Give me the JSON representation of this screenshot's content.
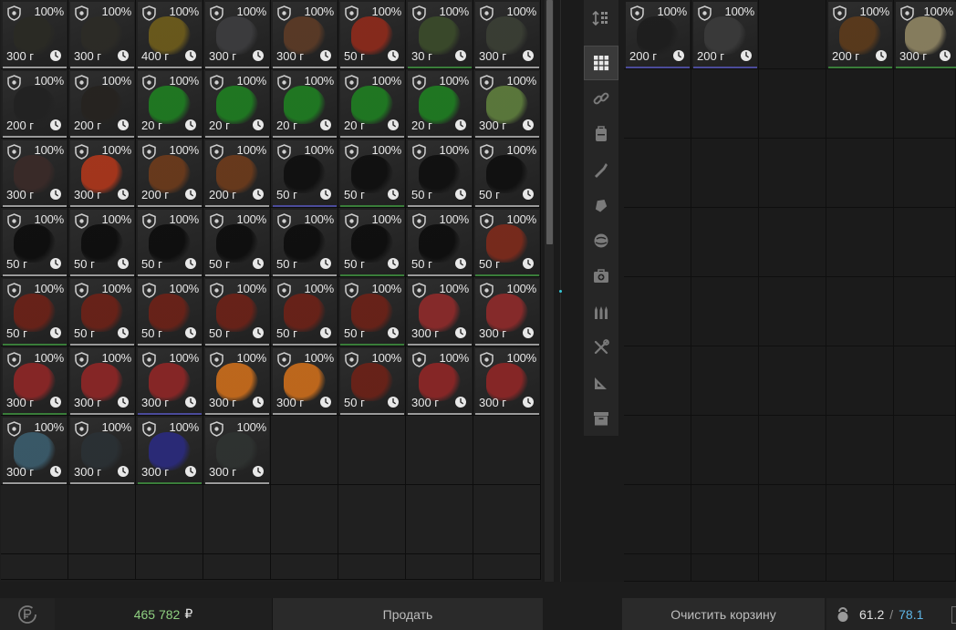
{
  "colors": {
    "accent": "#36c6d4",
    "balance": "#8fd080",
    "weight_max": "#5fb6e6"
  },
  "icons": {
    "item_badge": "shield-icon",
    "item_timer": "clock-icon",
    "refresh": "ruble-refresh-icon",
    "weight": "kettlebell-icon"
  },
  "inventory": {
    "items": [
      {
        "pct": "100%",
        "price": "300 г",
        "art": "#2a2a24",
        "r": "w"
      },
      {
        "pct": "100%",
        "price": "300 г",
        "art": "#2c2b26",
        "r": "w"
      },
      {
        "pct": "100%",
        "price": "400 г",
        "art": "#6b5a1c",
        "r": "w"
      },
      {
        "pct": "100%",
        "price": "300 г",
        "art": "#3c3c3e",
        "r": "w"
      },
      {
        "pct": "100%",
        "price": "300 г",
        "art": "#5a3a26",
        "r": "w"
      },
      {
        "pct": "100%",
        "price": "50 г",
        "art": "#8a2a1c",
        "r": "w"
      },
      {
        "pct": "100%",
        "price": "30 г",
        "art": "#3a4a2a",
        "r": "g"
      },
      {
        "pct": "100%",
        "price": "300 г",
        "art": "#3a3e34",
        "r": "w"
      },
      {
        "pct": "100%",
        "price": "200 г",
        "art": "#222222",
        "r": "w"
      },
      {
        "pct": "100%",
        "price": "200 г",
        "art": "#262320",
        "r": "w"
      },
      {
        "pct": "100%",
        "price": "20 г",
        "art": "#1f7a22",
        "r": "w"
      },
      {
        "pct": "100%",
        "price": "20 г",
        "art": "#1f7a22",
        "r": "w"
      },
      {
        "pct": "100%",
        "price": "20 г",
        "art": "#1f7a22",
        "r": "w"
      },
      {
        "pct": "100%",
        "price": "20 г",
        "art": "#1f7a22",
        "r": "w"
      },
      {
        "pct": "100%",
        "price": "20 г",
        "art": "#1f7a22",
        "r": "w"
      },
      {
        "pct": "100%",
        "price": "300 г",
        "art": "#5c7a3c",
        "r": "w"
      },
      {
        "pct": "100%",
        "price": "300 г",
        "art": "#3a2a28",
        "r": "w"
      },
      {
        "pct": "100%",
        "price": "300 г",
        "art": "#a8361c",
        "r": "w"
      },
      {
        "pct": "100%",
        "price": "200 г",
        "art": "#6a3a1c",
        "r": "w"
      },
      {
        "pct": "100%",
        "price": "200 г",
        "art": "#6a3a1c",
        "r": "w"
      },
      {
        "pct": "100%",
        "price": "50 г",
        "art": "#101010",
        "r": "p"
      },
      {
        "pct": "100%",
        "price": "50 г",
        "art": "#101010",
        "r": "g"
      },
      {
        "pct": "100%",
        "price": "50 г",
        "art": "#101010",
        "r": "w"
      },
      {
        "pct": "100%",
        "price": "50 г",
        "art": "#101010",
        "r": "w"
      },
      {
        "pct": "100%",
        "price": "50 г",
        "art": "#0e0e0e",
        "r": "w"
      },
      {
        "pct": "100%",
        "price": "50 г",
        "art": "#0e0e0e",
        "r": "w"
      },
      {
        "pct": "100%",
        "price": "50 г",
        "art": "#0e0e0e",
        "r": "w"
      },
      {
        "pct": "100%",
        "price": "50 г",
        "art": "#0e0e0e",
        "r": "w"
      },
      {
        "pct": "100%",
        "price": "50 г",
        "art": "#0e0e0e",
        "r": "w"
      },
      {
        "pct": "100%",
        "price": "50 г",
        "art": "#0e0e0e",
        "r": "g"
      },
      {
        "pct": "100%",
        "price": "50 г",
        "art": "#0e0e0e",
        "r": "w"
      },
      {
        "pct": "100%",
        "price": "50 г",
        "art": "#7a2a1c",
        "r": "g"
      },
      {
        "pct": "100%",
        "price": "50 г",
        "art": "#6a2218",
        "r": "g"
      },
      {
        "pct": "100%",
        "price": "50 г",
        "art": "#6a2218",
        "r": "w"
      },
      {
        "pct": "100%",
        "price": "50 г",
        "art": "#6a2218",
        "r": "w"
      },
      {
        "pct": "100%",
        "price": "50 г",
        "art": "#6a2218",
        "r": "w"
      },
      {
        "pct": "100%",
        "price": "50 г",
        "art": "#6a2218",
        "r": "w"
      },
      {
        "pct": "100%",
        "price": "50 г",
        "art": "#6a2218",
        "r": "g"
      },
      {
        "pct": "100%",
        "price": "300 г",
        "art": "#8a2a2a",
        "r": "w"
      },
      {
        "pct": "100%",
        "price": "300 г",
        "art": "#8a2a2a",
        "r": "w"
      },
      {
        "pct": "100%",
        "price": "300 г",
        "art": "#8a2626",
        "r": "g"
      },
      {
        "pct": "100%",
        "price": "300 г",
        "art": "#8a2626",
        "r": "w"
      },
      {
        "pct": "100%",
        "price": "300 г",
        "art": "#8a2626",
        "r": "p"
      },
      {
        "pct": "100%",
        "price": "300 г",
        "art": "#c46a1c",
        "r": "w"
      },
      {
        "pct": "100%",
        "price": "300 г",
        "art": "#c46a1c",
        "r": "w"
      },
      {
        "pct": "100%",
        "price": "50 г",
        "art": "#6a2218",
        "r": "w"
      },
      {
        "pct": "100%",
        "price": "300 г",
        "art": "#8a2626",
        "r": "w"
      },
      {
        "pct": "100%",
        "price": "300 г",
        "art": "#8a2626",
        "r": "w"
      },
      {
        "pct": "100%",
        "price": "300 г",
        "art": "#3a5a6a",
        "r": "w"
      },
      {
        "pct": "100%",
        "price": "300 г",
        "art": "#2a3034",
        "r": "w"
      },
      {
        "pct": "100%",
        "price": "300 г",
        "art": "#2a2a7a",
        "r": "g"
      },
      {
        "pct": "100%",
        "price": "300 г",
        "art": "#2e3230",
        "r": "w"
      }
    ]
  },
  "basket": {
    "items": [
      {
        "col": 0,
        "pct": "100%",
        "price": "200 г",
        "art": "#1e1e1e",
        "r": "p"
      },
      {
        "col": 1,
        "pct": "100%",
        "price": "200 г",
        "art": "#3a3a3a",
        "r": "p"
      },
      {
        "col": 3,
        "pct": "100%",
        "price": "200 г",
        "art": "#5a3a1c",
        "r": "g"
      },
      {
        "col": 4,
        "pct": "100%",
        "price": "300 г",
        "art": "#8a8060",
        "r": "g"
      }
    ]
  },
  "footer": {
    "balance_amount": "465 782",
    "balance_currency": "₽",
    "sell_label": "Продать",
    "clear_label": "Очистить корзину",
    "weight_current": "61.2",
    "weight_sep": "/",
    "weight_max": "78.1"
  }
}
